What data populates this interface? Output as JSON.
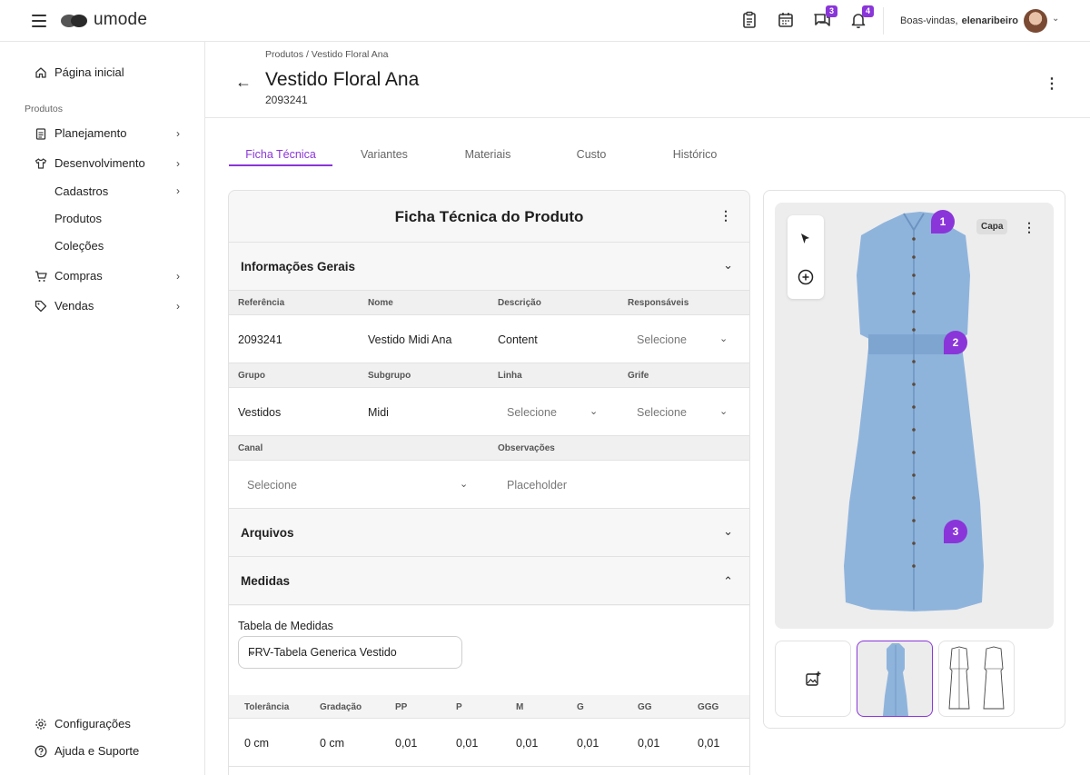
{
  "app": {
    "logo_text": "umode"
  },
  "topbar": {
    "badges": {
      "messages": "3",
      "notifications": "4"
    },
    "welcome": "Boas-vindas,",
    "username": "elenaribeiro"
  },
  "sidebar": {
    "home": "Página inicial",
    "section_label": "Produtos",
    "items": {
      "planejamento": "Planejamento",
      "desenvolvimento": "Desenvolvimento",
      "cadastros": "Cadastros",
      "produtos": "Produtos",
      "colecoes": "Coleções",
      "compras": "Compras",
      "vendas": "Vendas"
    },
    "bottom": {
      "config": "Configurações",
      "help": "Ajuda e Suporte"
    }
  },
  "header": {
    "breadcrumb": "Produtos  /  Vestido Floral Ana",
    "title": "Vestido Floral Ana",
    "code": "2093241"
  },
  "tabs": [
    "Ficha Técnica",
    "Variantes",
    "Materiais",
    "Custo",
    "Histórico"
  ],
  "card": {
    "title": "Ficha Técnica do Produto",
    "sections": {
      "geral": "Informações Gerais",
      "arquivos": "Arquivos",
      "medidas": "Medidas"
    },
    "labels_row1": [
      "Referência",
      "Nome",
      "Descrição",
      "Responsáveis"
    ],
    "values_row1": {
      "referencia": "2093241",
      "nome": "Vestido Midi Ana",
      "descricao": "Content",
      "responsaveis": "Selecione"
    },
    "labels_row2": [
      "Grupo",
      "Subgrupo",
      "Linha",
      "Grife"
    ],
    "values_row2": {
      "grupo": "Vestidos",
      "subgrupo": "Midi",
      "linha": "Selecione",
      "grife": "Selecione"
    },
    "labels_row3": [
      "Canal",
      "Observações"
    ],
    "values_row3": {
      "canal": "Selecione",
      "observacoes_placeholder": "Placeholder"
    },
    "medidas": {
      "table_label": "Tabela de Medidas",
      "table_value": "FRV-Tabela Generica Vestido",
      "columns": [
        "Tolerância",
        "Gradação",
        "PP",
        "P",
        "M",
        "G",
        "GG",
        "GGG"
      ],
      "row": [
        "0 cm",
        "0 cm",
        "0,01",
        "0,01",
        "0,01",
        "0,01",
        "0,01",
        "0,01"
      ]
    }
  },
  "image_panel": {
    "cover_badge": "Capa",
    "pins": [
      "1",
      "2",
      "3"
    ],
    "dress_color": "#8fb4dc",
    "accent": "#8a35d9"
  }
}
